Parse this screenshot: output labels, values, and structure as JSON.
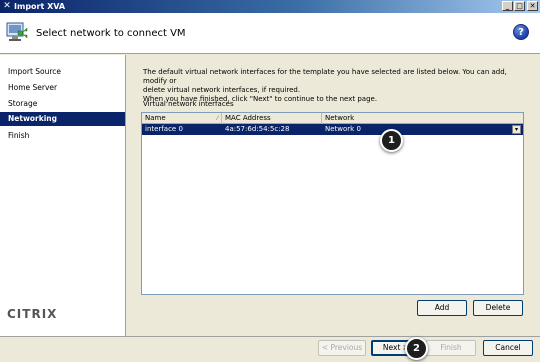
{
  "window": {
    "title": "Import XVA",
    "icon": "x-icon",
    "controls": [
      "minimize-icon",
      "maximize-icon",
      "close-icon"
    ]
  },
  "header": {
    "heading": "Select network to connect VM",
    "help": "?"
  },
  "sidebar": {
    "items": [
      {
        "label": "Import Source",
        "active": false
      },
      {
        "label": "Home Server",
        "active": false
      },
      {
        "label": "Storage",
        "active": false
      },
      {
        "label": "Networking",
        "active": true
      },
      {
        "label": "Finish",
        "active": false
      }
    ],
    "logo": "CITRIX"
  },
  "content": {
    "intro_line1": "The default virtual network interfaces for the template you have selected are listed below. You can add, modify or",
    "intro_line2": "delete virtual network interfaces, if required.",
    "intro_line3": "When you have finished, click \"Next\" to continue to the next page.",
    "list_label": "Virtual network interfaces",
    "columns": [
      "Name",
      "MAC Address",
      "Network"
    ],
    "rows": [
      {
        "name": "interface 0",
        "mac": "4a:57:6d:54:5c:28",
        "network": "Network 0"
      }
    ]
  },
  "buttons": {
    "add": "Add",
    "delete": "Delete",
    "previous": "< Previous",
    "next": "Next >",
    "finish": "Finish",
    "cancel": "Cancel"
  },
  "callouts": {
    "first": "1",
    "second": "2"
  },
  "colors": {
    "selection": "#0a246a",
    "title_bar": "#0a246a",
    "dialog_bg": "#ece9d8"
  }
}
